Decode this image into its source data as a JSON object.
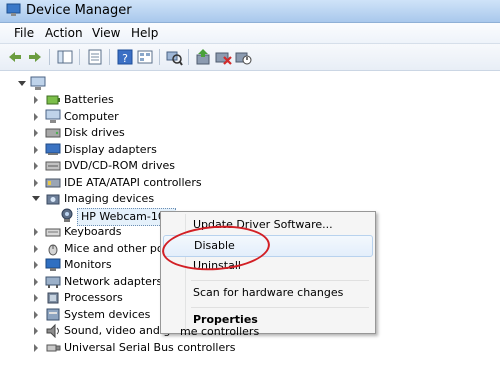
{
  "window": {
    "title": "Device Manager"
  },
  "menubar": {
    "file": "File",
    "action": "Action",
    "view": "View",
    "help": "Help"
  },
  "toolbar": {
    "buttons": [
      "back-icon",
      "forward-icon",
      "show-hide-console-tree-icon",
      "properties-icon",
      "help-icon",
      "view-icon",
      "scan-hardware-icon",
      "update-driver-icon",
      "uninstall-icon",
      "disable-device-icon"
    ]
  },
  "tree": {
    "root_icon": "computer-icon",
    "items": [
      {
        "label": "Batteries",
        "icon": "battery-icon",
        "expanded": false
      },
      {
        "label": "Computer",
        "icon": "computer-icon",
        "expanded": false
      },
      {
        "label": "Disk drives",
        "icon": "disk-drive-icon",
        "expanded": false
      },
      {
        "label": "Display adapters",
        "icon": "display-adapter-icon",
        "expanded": false
      },
      {
        "label": "DVD/CD-ROM drives",
        "icon": "optical-drive-icon",
        "expanded": false
      },
      {
        "label": "IDE ATA/ATAPI controllers",
        "icon": "controller-icon",
        "expanded": false
      },
      {
        "label": "Imaging devices",
        "icon": "camera-icon",
        "expanded": true
      },
      {
        "label": "HP Webcam-101",
        "icon": "webcam-icon",
        "child": true,
        "selected": true
      },
      {
        "label": "Keyboards",
        "icon": "keyboard-icon",
        "expanded": false
      },
      {
        "label": "Mice and other poi",
        "icon": "mouse-icon",
        "expanded": false
      },
      {
        "label": "Monitors",
        "icon": "monitor-icon",
        "expanded": false
      },
      {
        "label": "Network adapters",
        "icon": "network-adapter-icon",
        "expanded": false
      },
      {
        "label": "Processors",
        "icon": "processor-icon",
        "expanded": false
      },
      {
        "label": "System devices",
        "icon": "system-device-icon",
        "expanded": false
      },
      {
        "label": "Sound, video and ga",
        "icon": "sound-icon",
        "expanded": false
      },
      {
        "label": "Universal Serial Bus controllers",
        "icon": "usb-icon",
        "expanded": false
      }
    ]
  },
  "context_menu": {
    "update": "Update Driver Software...",
    "disable": "Disable",
    "uninstall": "Uninstall",
    "scan": "Scan for hardware changes",
    "properties": "Properties",
    "tail_text": "me controllers"
  },
  "colors": {
    "highlight": "#d21f25",
    "title_bar": "#bcd6f2"
  }
}
